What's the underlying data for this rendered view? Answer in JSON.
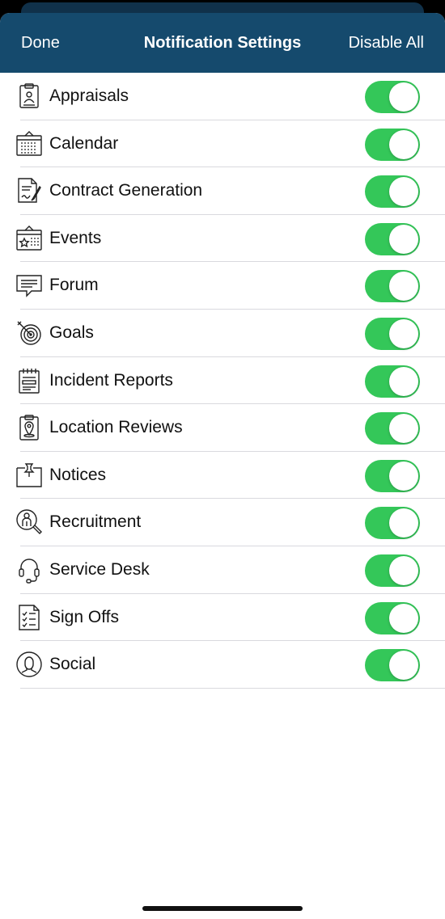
{
  "header": {
    "done_label": "Done",
    "title": "Notification Settings",
    "disable_all_label": "Disable All"
  },
  "colors": {
    "header_bg": "#154a6d",
    "toggle_on": "#34c759"
  },
  "settings": [
    {
      "label": "Appraisals",
      "icon": "appraisals-icon",
      "enabled": true
    },
    {
      "label": "Calendar",
      "icon": "calendar-icon",
      "enabled": true
    },
    {
      "label": "Contract Generation",
      "icon": "contract-icon",
      "enabled": true
    },
    {
      "label": "Events",
      "icon": "events-icon",
      "enabled": true
    },
    {
      "label": "Forum",
      "icon": "forum-icon",
      "enabled": true
    },
    {
      "label": "Goals",
      "icon": "goals-icon",
      "enabled": true
    },
    {
      "label": "Incident Reports",
      "icon": "incident-reports-icon",
      "enabled": true
    },
    {
      "label": "Location Reviews",
      "icon": "location-reviews-icon",
      "enabled": true
    },
    {
      "label": "Notices",
      "icon": "notices-icon",
      "enabled": true
    },
    {
      "label": "Recruitment",
      "icon": "recruitment-icon",
      "enabled": true
    },
    {
      "label": "Service Desk",
      "icon": "service-desk-icon",
      "enabled": true
    },
    {
      "label": "Sign Offs",
      "icon": "sign-offs-icon",
      "enabled": true
    },
    {
      "label": "Social",
      "icon": "social-icon",
      "enabled": true
    }
  ]
}
